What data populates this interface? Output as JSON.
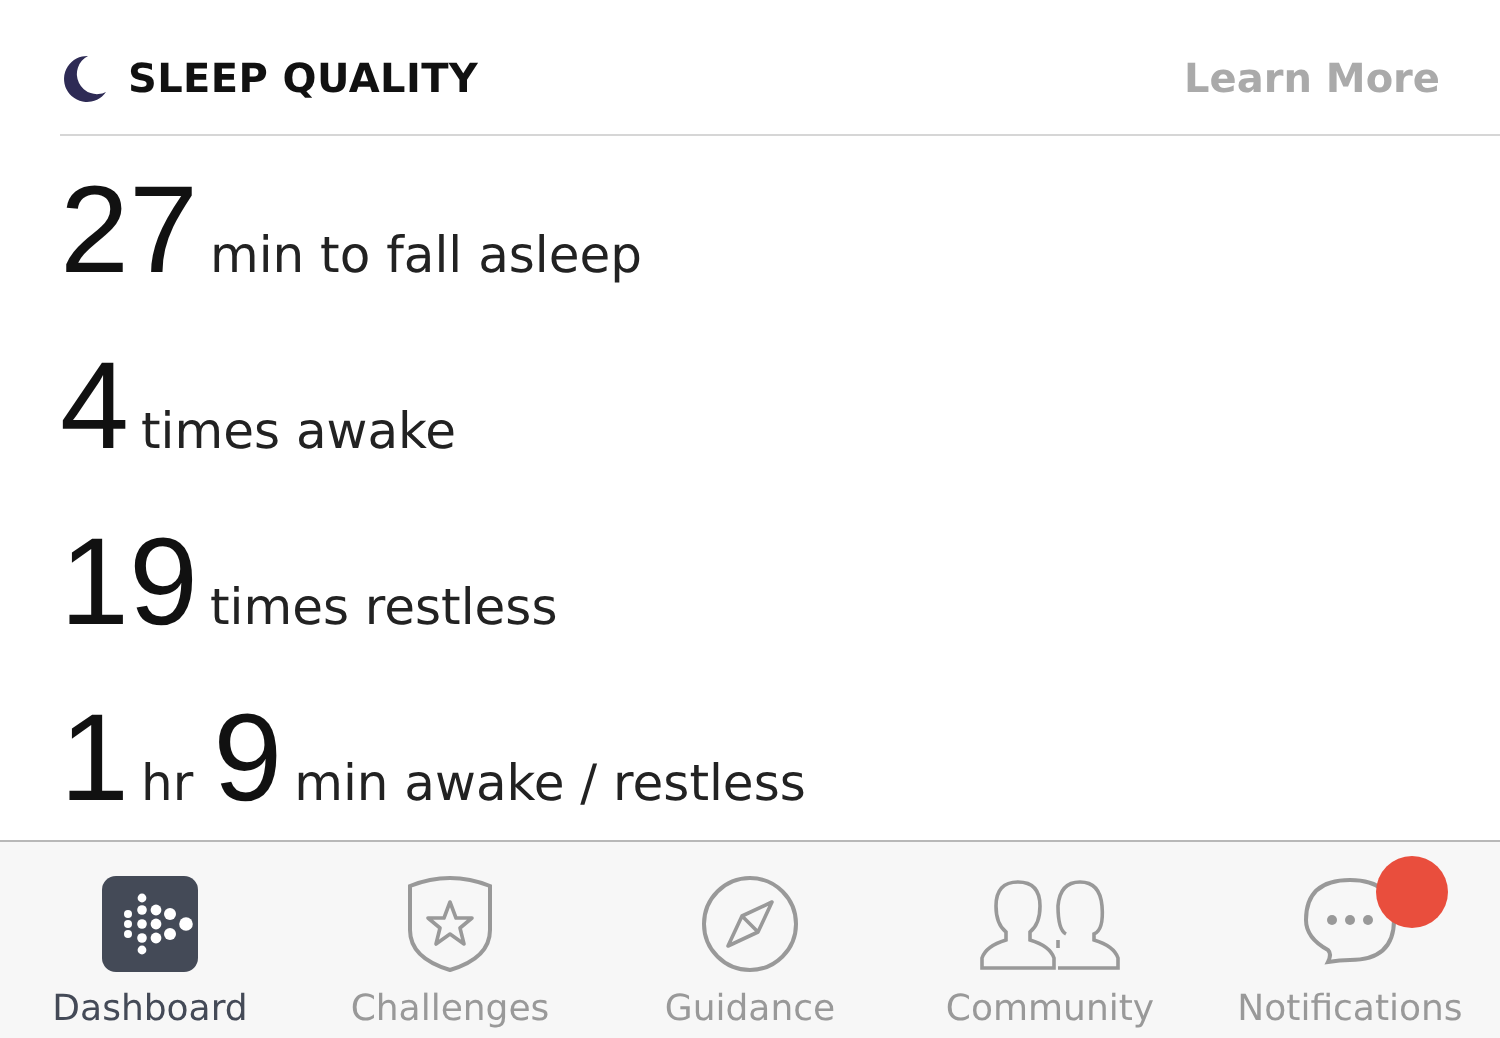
{
  "section": {
    "title": "SLEEP QUALITY",
    "link": "Learn More"
  },
  "stats": [
    {
      "parts": [
        {
          "value": "27",
          "unit": "min to fall asleep"
        }
      ]
    },
    {
      "parts": [
        {
          "value": "4",
          "unit": "times awake"
        }
      ]
    },
    {
      "parts": [
        {
          "value": "19",
          "unit": "times restless"
        }
      ]
    },
    {
      "parts": [
        {
          "value": "1",
          "unit": "hr"
        },
        {
          "value": "9",
          "unit": "min awake / restless"
        }
      ]
    }
  ],
  "tabs": [
    {
      "label": "Dashboard",
      "kind": "dashboard",
      "selected": true,
      "badge": false
    },
    {
      "label": "Challenges",
      "kind": "challenges",
      "selected": false,
      "badge": false
    },
    {
      "label": "Guidance",
      "kind": "guidance",
      "selected": false,
      "badge": false
    },
    {
      "label": "Community",
      "kind": "community",
      "selected": false,
      "badge": false
    },
    {
      "label": "Notifications",
      "kind": "notifications",
      "selected": false,
      "badge": true
    }
  ]
}
